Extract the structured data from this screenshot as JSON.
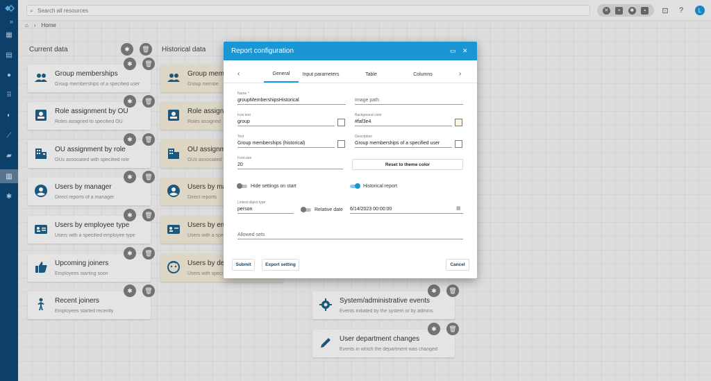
{
  "topbar": {
    "search_placeholder": "Search all resources"
  },
  "breadcrumb": {
    "home": "Home"
  },
  "columns": {
    "current": "Current data",
    "historical": "Historical data"
  },
  "current_cards": [
    {
      "title": "Group memberships",
      "subtitle": "Group memberships of a specified user",
      "icon": "group-icon"
    },
    {
      "title": "Role assignment by OU",
      "subtitle": "Roles assigned to specified OU",
      "icon": "badge-icon"
    },
    {
      "title": "OU assignment by role",
      "subtitle": "OUs associated with specified role",
      "icon": "building-icon"
    },
    {
      "title": "Users by manager",
      "subtitle": "Direct reports of a manager",
      "icon": "account-circle-icon"
    },
    {
      "title": "Users by employee type",
      "subtitle": "Users with a specified employee type",
      "icon": "id-card-icon"
    },
    {
      "title": "Upcoming joiners",
      "subtitle": "Employees starting soon",
      "icon": "thumb-up-icon"
    },
    {
      "title": "Recent joiners",
      "subtitle": "Employees started recently",
      "icon": "person-icon"
    }
  ],
  "historical_cards": [
    {
      "title": "Group memb",
      "subtitle": "Group membe"
    },
    {
      "title": "Role assign",
      "subtitle": "Roles assigned"
    },
    {
      "title": "OU assignm",
      "subtitle": "OUs associated w"
    },
    {
      "title": "Users by ma",
      "subtitle": "Direct reports"
    },
    {
      "title": "Users by emp",
      "subtitle": "Users with a spec"
    },
    {
      "title": "Users by dep",
      "subtitle": "Users with speci"
    }
  ],
  "event_cards": [
    {
      "title": "System/administrative events",
      "subtitle": "Events initiated by the system or by admins"
    },
    {
      "title": "User department changes",
      "subtitle": "Events in which the department was changed"
    }
  ],
  "dialog": {
    "title": "Report configuration",
    "tabs": [
      "General",
      "Input parameters",
      "Table",
      "Columns"
    ],
    "name_label": "Name *",
    "name_value": "groupMembershipsHistorical",
    "image_path_label": "Image path",
    "icon_text_label": "Icon text",
    "icon_text_value": "group",
    "bg_color_label": "Background color",
    "bg_color_value": "#faf3e4",
    "text_label": "Text",
    "text_value": "Group memberships (historical)",
    "description_label": "Description",
    "description_value": "Group memberships of a specified user",
    "font_size_label": "Font size",
    "font_size_value": "20",
    "reset_button": "Reset to theme color",
    "hide_settings_label": "Hide settings on start",
    "historical_report_label": "Historical report",
    "linked_object_label": "Linked object type",
    "linked_object_value": "person",
    "relative_date_label": "Relative date",
    "date_value": "6/14/2023 00:00:00",
    "allowed_sets_label": "Allowed sets",
    "submit": "Submit",
    "export": "Export setting",
    "cancel": "Cancel"
  },
  "avatar_letter": "L",
  "colors": {
    "accent": "#1a96d4",
    "rail": "#0d4470",
    "icon_blue": "#1d5c85",
    "historical_card": "#ece4d2"
  }
}
